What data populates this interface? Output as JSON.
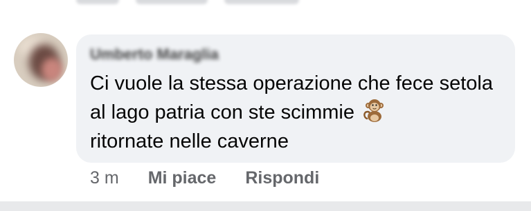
{
  "previous_comment_actions": [],
  "comment": {
    "author": "Umberto Maraglia",
    "text": "Ci vuole la stessa operazione che fece setola al lago patria con ste scimmie",
    "text_after_emoji": "ritornate nelle caverne",
    "emoji_icon": "monkey-emoji-icon",
    "time": "3 m",
    "like_label": "Mi piace",
    "reply_label": "Rispondi"
  },
  "colors": {
    "bubble_bg": "#f0f2f5",
    "meta_text": "#65676b",
    "text": "#050505"
  }
}
